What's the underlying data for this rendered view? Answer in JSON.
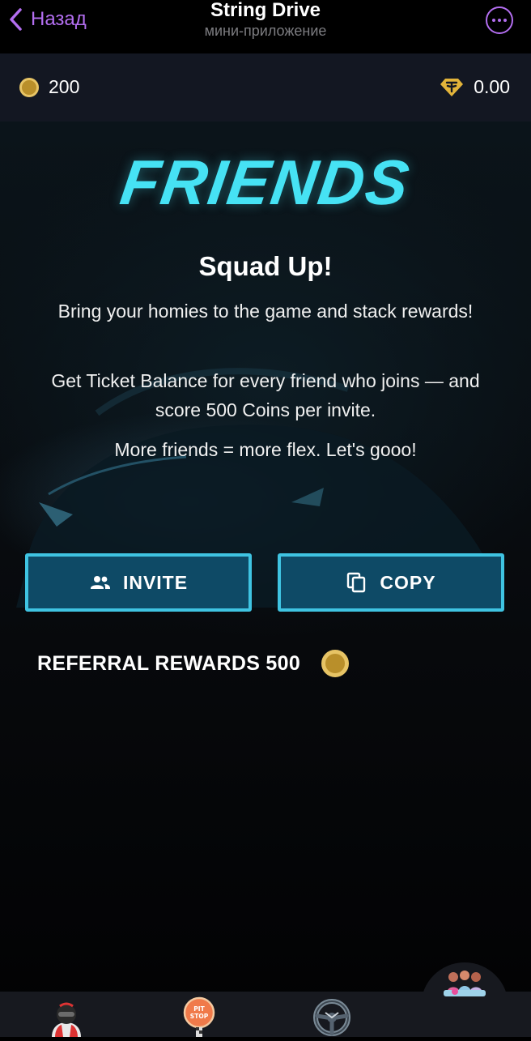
{
  "header": {
    "back_label": "Назад",
    "title": "String Drive",
    "subtitle": "мини-приложение"
  },
  "balance": {
    "coins": "200",
    "ton": "0.00"
  },
  "main": {
    "logo_text": "FRIENDS",
    "heading": "Squad Up!",
    "paragraph1": "Bring your homies to the game and stack rewards!",
    "paragraph2": "Get Ticket Balance for every friend who joins — and score 500 Coins per invite.",
    "paragraph3": "More friends = more flex. Let's gooo!",
    "invite_label": "INVITE",
    "copy_label": "COPY",
    "rewards_label": "REFERRAL REWARDS 500"
  },
  "colors": {
    "accent": "#b36ef0",
    "logo": "#46e2f4",
    "button_fill": "#0e4a66",
    "button_border": "#3fc4e2",
    "coin": "#e7c465"
  },
  "bottom_nav": {
    "items": [
      "racer-icon",
      "pit-stop-icon",
      "steering-wheel-icon",
      "friends-group-icon"
    ],
    "active": "friends-group-icon",
    "pit_stop_icon_text": "PIT STOP"
  }
}
